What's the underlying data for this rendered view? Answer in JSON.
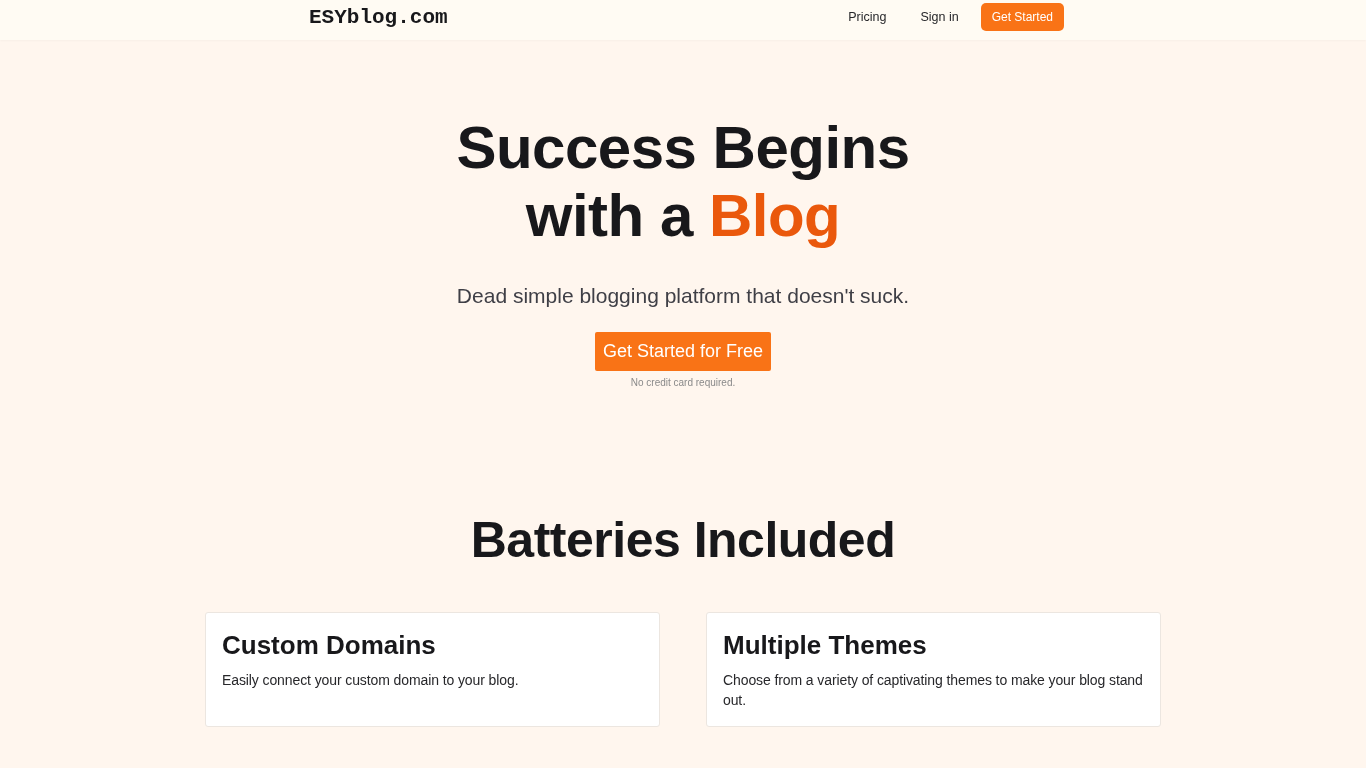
{
  "header": {
    "logo": "ESYblog.com",
    "nav": [
      {
        "label": "Pricing",
        "kind": "link"
      },
      {
        "label": "Sign in",
        "kind": "link"
      },
      {
        "label": "Get Started",
        "kind": "button"
      }
    ]
  },
  "hero": {
    "title": "Success Begins with a",
    "highlight": "Blog",
    "subtitle": "Dead simple blogging platform that doesn't suck.",
    "cta": "Get Started for Free",
    "note": "No credit card required."
  },
  "features": {
    "title": "Batteries Included",
    "cards": [
      {
        "title": "Custom Domains",
        "description": "Easily connect your custom domain to your blog."
      },
      {
        "title": "Multiple Themes",
        "description": "Choose from a variety of captivating themes to make your blog stand out."
      }
    ]
  }
}
